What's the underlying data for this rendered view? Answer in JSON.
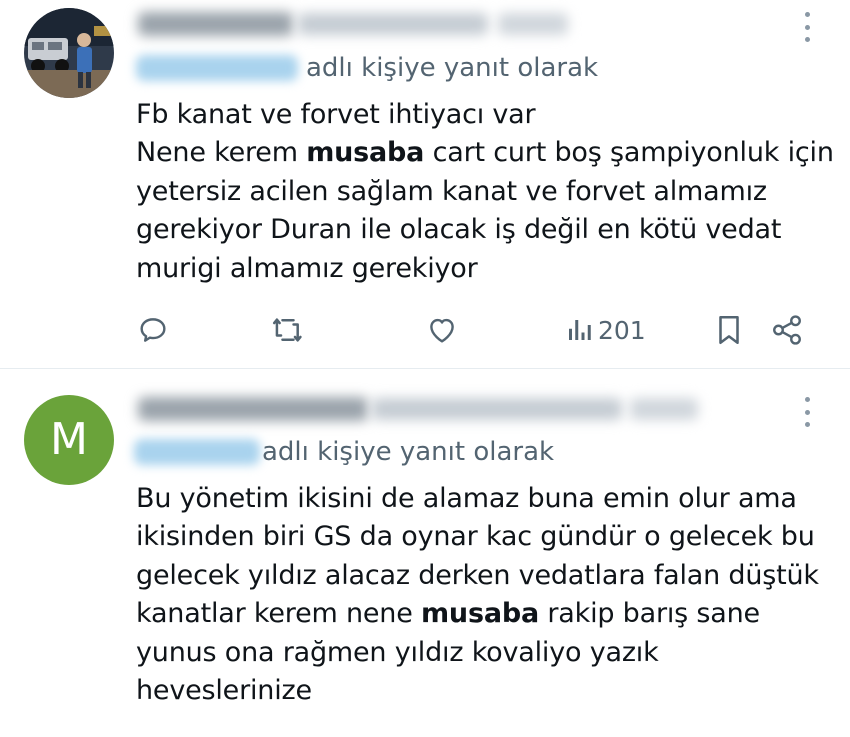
{
  "tweets": [
    {
      "avatar": {
        "icon": "profile-photo-icon"
      },
      "reply_label": "adlı kişiye yanıt olarak",
      "body": {
        "line1": "Fb kanat ve forvet ihtiyacı var",
        "line2_a": "Nene kerem ",
        "line2_bold": "musaba",
        "line2_b": " cart curt boş şampiyonluk için",
        "line3": "yetersiz acilen sağlam kanat ve forvet almamız",
        "line4": "gerekiyor Duran ile olacak iş değil en kötü vedat",
        "line5": "murigi almamız gerekiyor"
      },
      "actions": {
        "reply_icon": "reply-icon",
        "retweet_icon": "retweet-icon",
        "like_icon": "heart-icon",
        "views_icon": "views-icon",
        "views_count": "201",
        "bookmark_icon": "bookmark-icon",
        "share_icon": "share-icon"
      }
    },
    {
      "avatar": {
        "letter": "M",
        "color": "#6aa33a"
      },
      "reply_label": "adlı kişiye yanıt olarak",
      "body": {
        "line1": "Bu yönetim ikisini de alamaz buna emin olur ama",
        "line2": "ikisinden biri GS da oynar kac gündür o gelecek bu",
        "line3": "gelecek yıldız alacaz derken vedatlara falan düştük",
        "line4_a": "kanatlar kerem nene ",
        "line4_bold": "musaba",
        "line4_b": " rakip barış sane",
        "line5": "yunus ona rağmen yıldız kovaliyo yazık",
        "line6": "heveslerinize"
      }
    }
  ],
  "colors": {
    "text": "#0f1419",
    "muted": "#536471",
    "divider": "#e6ecf0",
    "avatar_green": "#6aa33a"
  }
}
